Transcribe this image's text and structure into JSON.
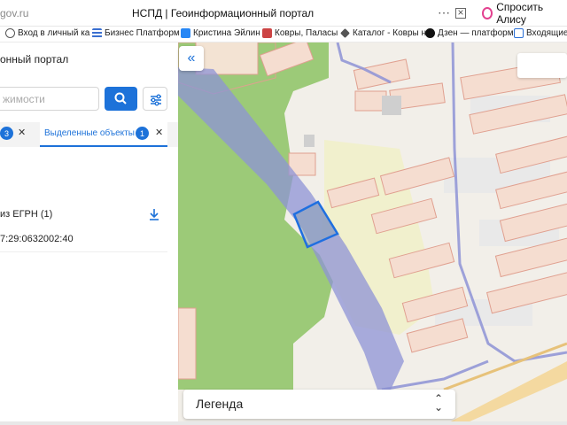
{
  "browser": {
    "url_fragment": "gov.ru",
    "tab_title": "НСПД | Геоинформационный портал",
    "ask_label": "Спросить Алису"
  },
  "bookmarks": [
    {
      "label": "Вход в личный ка",
      "icon": "globe-icon"
    },
    {
      "label": "Бизнес Платформ",
      "icon": "list-icon"
    },
    {
      "label": "Кристина Эйлин",
      "icon": "vk-icon"
    },
    {
      "label": "Ковры, Паласы",
      "icon": "site-icon"
    },
    {
      "label": "Каталог - Ковры н",
      "icon": "tag-icon"
    },
    {
      "label": "Дзен — платформ",
      "icon": "dzen-icon"
    },
    {
      "label": "Входящие",
      "icon": "mail-icon"
    }
  ],
  "panel": {
    "portal_title": "онный портал",
    "search_placeholder": "жимости",
    "tab_count_1": "3",
    "tab_2_label": "Выделенные объекты",
    "tab_count_2": "1",
    "egrn_label": "из ЕГРН (1)",
    "cadastral_number": "7:29:0632002:40"
  },
  "map": {
    "legend_label": "Легенда",
    "collapse_icon": "double-chevron-left-icon"
  },
  "colors": {
    "accent": "#1d72d9",
    "forest": "#9cca78",
    "selection": "#1f6fe0",
    "corridor": "#8e93d6",
    "parcel_border": "#e0a090"
  }
}
